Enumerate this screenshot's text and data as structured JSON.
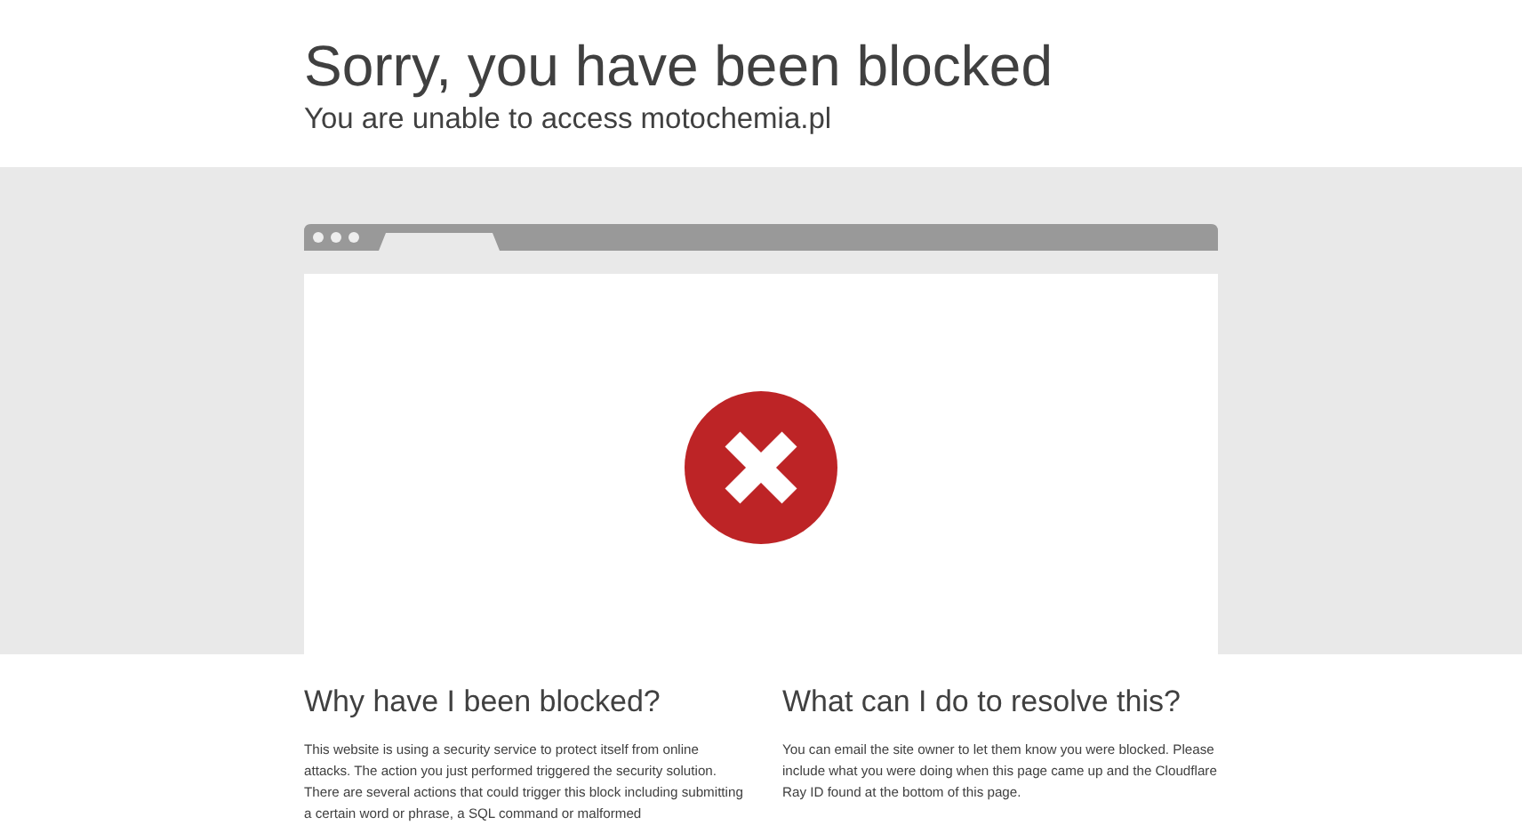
{
  "header": {
    "title": "Sorry, you have been blocked",
    "subtitle": "You are unable to access motochemia.pl"
  },
  "sections": [
    {
      "heading": "Why have I been blocked?",
      "text": "This website is using a security service to protect itself from online attacks. The action you just performed triggered the security solution. There are several actions that could trigger this block including submitting a certain word or phrase, a SQL command or malformed"
    },
    {
      "heading": "What can I do to resolve this?",
      "text": "You can email the site owner to let them know you were blocked. Please include what you were doing when this page came up and the Cloudflare Ray ID found at the bottom of this page."
    }
  ]
}
